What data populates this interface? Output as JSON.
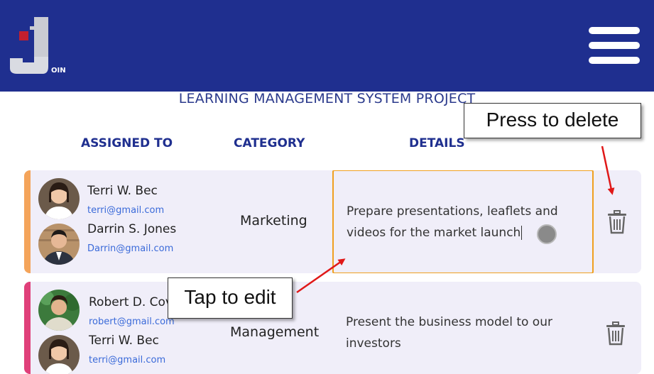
{
  "app": {
    "logo_text": "OIN"
  },
  "project": {
    "title": "LEARNING MANAGEMENT SYSTEM PROJECT"
  },
  "columns": {
    "assigned_to": "ASSIGNED TO",
    "category": "CATEGORY",
    "details": "DETAILS"
  },
  "tasks": [
    {
      "accent_color": "#f4a45a",
      "people": [
        {
          "name": "Terri W. Bec",
          "email": "terri@gmail.com"
        },
        {
          "name": "Darrin S. Jones",
          "email": "Darrin@gmail.com"
        }
      ],
      "category": "Marketing",
      "details": "Prepare presentations, leaflets and videos for the market launch",
      "editing": true
    },
    {
      "accent_color": "#e0407a",
      "people": [
        {
          "name": "Robert D. Cov",
          "email": "robert@gmail.com"
        },
        {
          "name": "Terri W. Bec",
          "email": "terri@gmail.com"
        }
      ],
      "category": "Management",
      "details": "Present the business model to our investors",
      "editing": false
    }
  ],
  "callouts": {
    "delete": "Press to delete",
    "edit": "Tap to edit"
  },
  "colors": {
    "header": "#1f2f8f",
    "card_bg": "#f0eef9",
    "edit_border": "#f0a020",
    "email": "#3a6ad9",
    "arrow": "#e01818"
  },
  "icons": {
    "menu": "hamburger-icon",
    "delete": "trash-icon"
  }
}
